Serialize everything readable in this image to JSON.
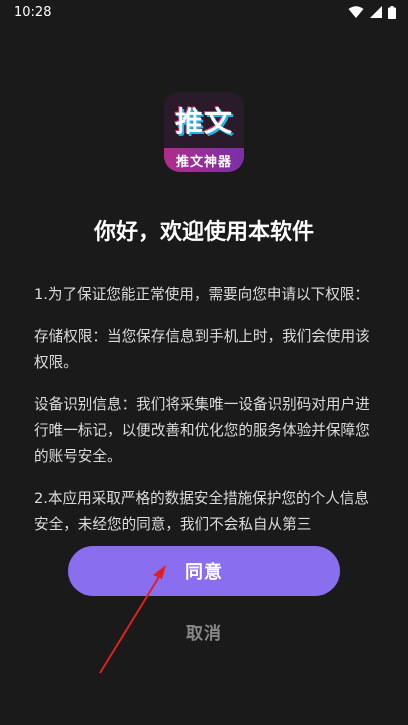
{
  "status_bar": {
    "time": "10:28",
    "icons": [
      "wifi-icon",
      "signal-icon",
      "battery-icon"
    ]
  },
  "logo": {
    "main_text": "推文",
    "sub_text": "推文神器"
  },
  "dialog": {
    "title": "你好，欢迎使用本软件",
    "paragraphs": [
      "1.为了保证您能正常使用，需要向您申请以下权限：",
      "存储权限：当您保存信息到手机上时，我们会使用该权限。",
      "设备识别信息：我们将采集唯一设备识别码对用户进行唯一标记，以便改善和优化您的服务体验并保障您的账号安全。",
      "2.本应用采取严格的数据安全措施保护您的个人信息安全，未经您的同意，我们不会私自从第三"
    ],
    "agree_label": "同意",
    "cancel_label": "取消"
  },
  "colors": {
    "background": "#1a1a1a",
    "agree_button": "#8a6ef0",
    "cancel_text": "#888888",
    "annotation_arrow": "#e02020"
  }
}
